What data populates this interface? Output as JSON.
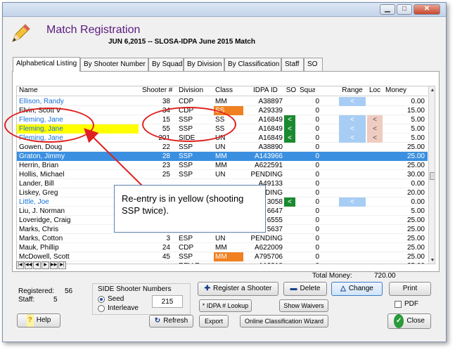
{
  "window": {
    "app_title": "Match Registration",
    "match_line": "JUN  6,2015 -- SLOSA-IDPA June 2015 Match"
  },
  "tabs": [
    {
      "label": "Alphabetical Listing"
    },
    {
      "label": "By Shooter Number"
    },
    {
      "label": "By Squad"
    },
    {
      "label": "By Division"
    },
    {
      "label": "By Classification"
    },
    {
      "label": "Staff"
    },
    {
      "label": "SO"
    }
  ],
  "table": {
    "headers": {
      "name": "Name",
      "num": "Shooter #",
      "div": "Division",
      "class": "Class",
      "idpa": "IDPA ID",
      "so": "SO",
      "squad": "Squad",
      "range": "Range",
      "loc": "Loc",
      "money": "Money"
    },
    "rows": [
      {
        "name": "Ellison, Randy",
        "num": "38",
        "div": "CDP",
        "class": "MM",
        "idpa": "A38897",
        "so": "",
        "squad": "0",
        "range": "<",
        "loc": "",
        "money": "0.00"
      },
      {
        "name": "Elvin, Scott V",
        "num": "34",
        "div": "CDP",
        "class": "SS",
        "idpa": "A29339",
        "so": "",
        "squad": "0",
        "range": "",
        "loc": "",
        "money": "15.00"
      },
      {
        "name": "Fleming, Jane",
        "num": "15",
        "div": "SSP",
        "class": "SS",
        "idpa": "A16849",
        "so": "<",
        "squad": "0",
        "range": "<",
        "loc": "<",
        "money": "5.00"
      },
      {
        "name": "Fleming, Jane",
        "num": "55",
        "div": "SSP",
        "class": "SS",
        "idpa": "A16849",
        "so": "<",
        "squad": "0",
        "range": "<",
        "loc": "<",
        "money": "5.00"
      },
      {
        "name": "Fleming, Jane",
        "num": "201",
        "div": "SIDE",
        "class": "UN",
        "idpa": "A16849",
        "so": "<",
        "squad": "0",
        "range": "<",
        "loc": "<",
        "money": "5.00"
      },
      {
        "name": "Gowen, Doug",
        "num": "22",
        "div": "SSP",
        "class": "UN",
        "idpa": "A38890",
        "so": "",
        "squad": "0",
        "range": "",
        "loc": "",
        "money": "25.00"
      },
      {
        "name": "Graton, Jimmy",
        "num": "28",
        "div": "SSP",
        "class": "MM",
        "idpa": "A143966",
        "so": "",
        "squad": "0",
        "range": "",
        "loc": "",
        "money": "25.00"
      },
      {
        "name": "Herrin, Brian",
        "num": "23",
        "div": "SSP",
        "class": "MM",
        "idpa": "A622591",
        "so": "",
        "squad": "0",
        "range": "",
        "loc": "",
        "money": "25.00"
      },
      {
        "name": "Hollis, Michael",
        "num": "25",
        "div": "SSP",
        "class": "UN",
        "idpa": "PENDING",
        "so": "",
        "squad": "0",
        "range": "",
        "loc": "",
        "money": "30.00"
      },
      {
        "name": "Lander, Bill",
        "num": "",
        "div": "",
        "class": "",
        "idpa": "A49133",
        "so": "",
        "squad": "0",
        "range": "",
        "loc": "",
        "money": "0.00"
      },
      {
        "name": "Liskey, Greg",
        "num": "",
        "div": "",
        "class": "",
        "idpa": "NDING",
        "so": "",
        "squad": "0",
        "range": "",
        "loc": "",
        "money": "20.00"
      },
      {
        "name": "Little, Joe",
        "num": "",
        "div": "",
        "class": "",
        "idpa": "3058",
        "so": "<",
        "squad": "0",
        "range": "<",
        "loc": "",
        "money": "0.00"
      },
      {
        "name": "Liu, J. Norman",
        "num": "",
        "div": "",
        "class": "",
        "idpa": "6647",
        "so": "",
        "squad": "0",
        "range": "",
        "loc": "",
        "money": "5.00"
      },
      {
        "name": "Loveridge, Craig",
        "num": "",
        "div": "",
        "class": "",
        "idpa": "6555",
        "so": "",
        "squad": "0",
        "range": "",
        "loc": "",
        "money": "25.00"
      },
      {
        "name": "Marks, Chris",
        "num": "",
        "div": "",
        "class": "",
        "idpa": "5637",
        "so": "",
        "squad": "0",
        "range": "",
        "loc": "",
        "money": "25.00"
      },
      {
        "name": "Marks, Cotton",
        "num": "3",
        "div": "ESP",
        "class": "UN",
        "idpa": "PENDING",
        "so": "",
        "squad": "0",
        "range": "",
        "loc": "",
        "money": "25.00"
      },
      {
        "name": "Mauk, Phillip",
        "num": "24",
        "div": "CDP",
        "class": "MM",
        "idpa": "A622009",
        "so": "",
        "squad": "0",
        "range": "",
        "loc": "",
        "money": "25.00"
      },
      {
        "name": "McDowell, Scott",
        "num": "45",
        "div": "SSP",
        "class": "MM",
        "idpa": "A795706",
        "so": "",
        "squad": "0",
        "range": "",
        "loc": "",
        "money": "25.00"
      },
      {
        "name": "Messenger, ...",
        "num": "",
        "div": "REV-F",
        "class": "",
        "idpa": "A13318",
        "so": "",
        "squad": "0",
        "range": "",
        "loc": "",
        "money": "25.00"
      }
    ]
  },
  "callout": {
    "text": "Re-entry is in yellow (shooting SSP twice)."
  },
  "totals": {
    "total_money_label": "Total Money:",
    "total_money_value": "720.00",
    "registered_label": "Registered:",
    "registered_value": "56",
    "staff_label": "Staff:",
    "staff_value": "5"
  },
  "side_numbers": {
    "legend": "SIDE Shooter Numbers",
    "seed_label": "Seed",
    "interleave_label": "Interleave",
    "value": "215"
  },
  "buttons": {
    "register": "Register a Shooter",
    "delete": "Delete",
    "change": "Change",
    "print": "Print",
    "idpa_lookup": "* IDPA # Lookup",
    "show_waivers": "Show Waivers",
    "pdf": "PDF",
    "help": "Help",
    "refresh": "Refresh",
    "export": "Export",
    "classification_wizard": "Online Classification Wizard",
    "close": "Close"
  },
  "colors": {
    "title": "#5a1b7d",
    "selected_row": "#3b8fe0",
    "reentry_highlight": "#ffff00",
    "callout_border": "#e02020",
    "so_green": "#1a8a30",
    "class_orange": "#f08020"
  }
}
